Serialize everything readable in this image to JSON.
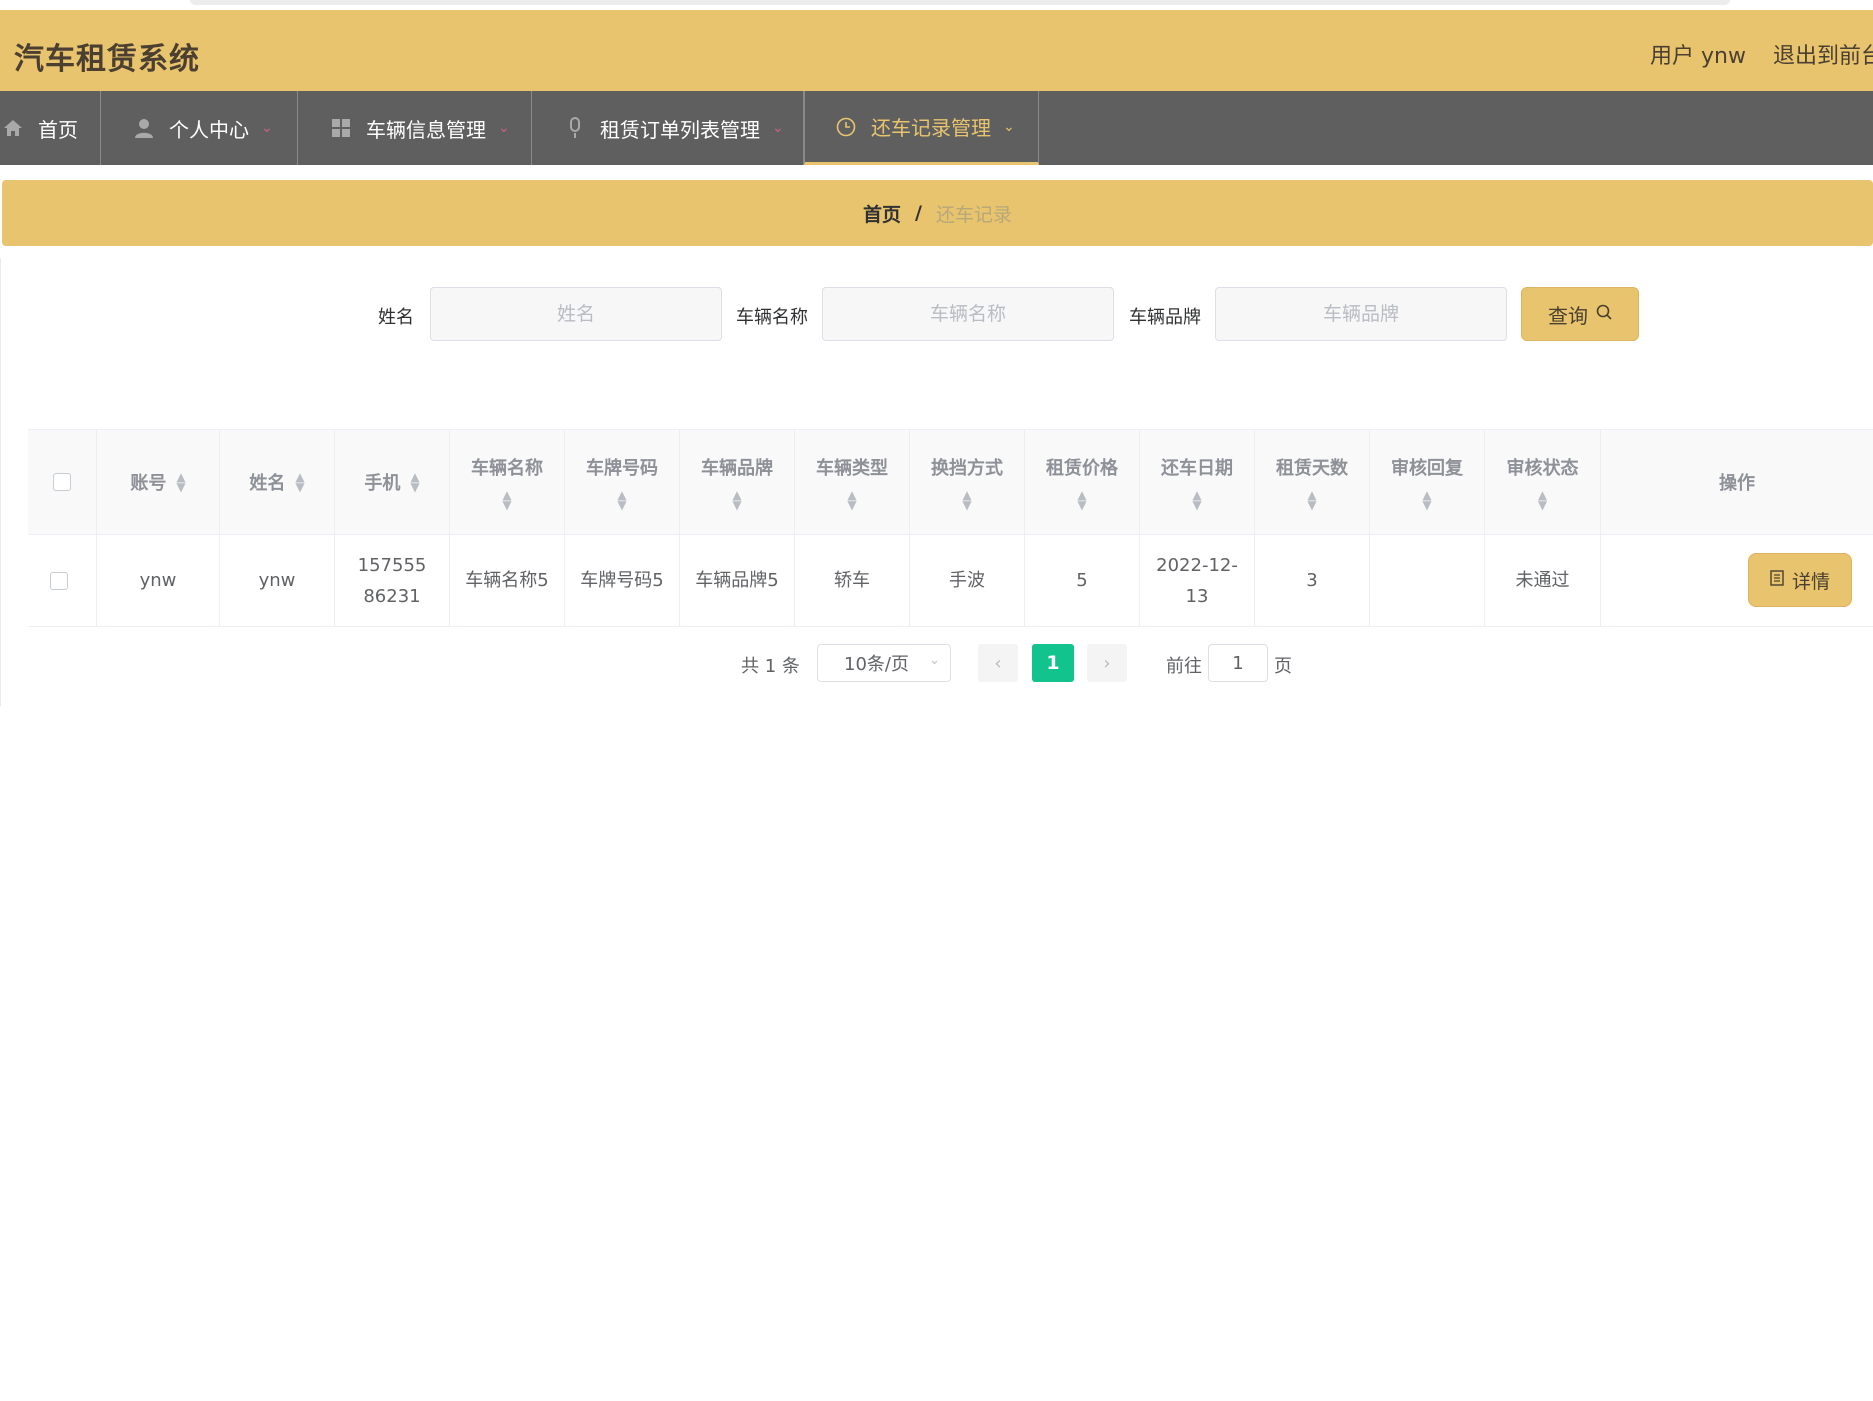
{
  "header": {
    "title": "汽车租赁系统",
    "user_label": "用户 ynw",
    "logout_label": "退出到前台"
  },
  "nav": {
    "items": [
      {
        "label": "首页",
        "icon": "home-icon"
      },
      {
        "label": "个人中心",
        "icon": "user-icon"
      },
      {
        "label": "车辆信息管理",
        "icon": "grid-icon"
      },
      {
        "label": "租赁订单列表管理",
        "icon": "microphone-icon"
      },
      {
        "label": "还车记录管理",
        "icon": "clock-icon",
        "active": true
      }
    ]
  },
  "breadcrumb": {
    "home": "首页",
    "separator": "/",
    "current": "还车记录"
  },
  "search": {
    "name_label": "姓名",
    "name_placeholder": "姓名",
    "vehicle_name_label": "车辆名称",
    "vehicle_name_placeholder": "车辆名称",
    "vehicle_brand_label": "车辆品牌",
    "vehicle_brand_placeholder": "车辆品牌",
    "query_button": "查询"
  },
  "table": {
    "columns": [
      "账号",
      "姓名",
      "手机",
      "车辆名称",
      "车牌号码",
      "车辆品牌",
      "车辆类型",
      "换挡方式",
      "租赁价格",
      "还车日期",
      "租赁天数",
      "审核回复",
      "审核状态",
      "操作"
    ],
    "rows": [
      {
        "account": "ynw",
        "name": "ynw",
        "phone": "15755586231",
        "vehicle_name": "车辆名称5",
        "plate": "车牌号码5",
        "brand": "车辆品牌5",
        "type": "轿车",
        "gear": "手波",
        "price": "5",
        "return_date": "2022-12-13",
        "days": "3",
        "review_reply": "",
        "review_status": "未通过",
        "action": "详情"
      }
    ]
  },
  "pagination": {
    "total": "共 1 条",
    "page_size": "10条/页",
    "current_page": "1",
    "goto_label": "前往",
    "goto_value": "1",
    "page_unit": "页"
  },
  "colors": {
    "accent": "#e8c46e",
    "nav_bg": "#5f5f5f",
    "active_page": "#13c38d"
  }
}
